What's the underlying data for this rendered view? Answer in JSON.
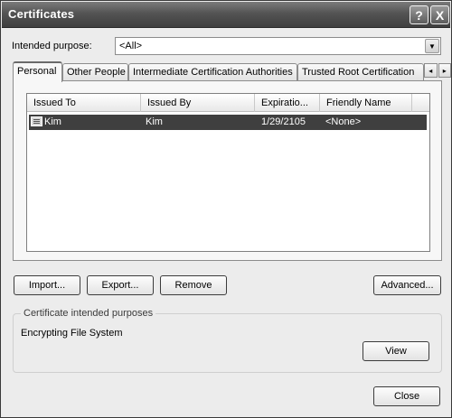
{
  "window": {
    "title": "Certificates",
    "help_glyph": "?",
    "close_glyph": "X"
  },
  "intended_purpose": {
    "label": "Intended purpose:",
    "value": "<All>"
  },
  "tabs": [
    {
      "label": "Personal",
      "active": true
    },
    {
      "label": "Other People",
      "active": false
    },
    {
      "label": "Intermediate Certification Authorities",
      "active": false
    },
    {
      "label": "Trusted Root Certification",
      "active": false
    }
  ],
  "tab_scroll": {
    "left_glyph": "◂",
    "right_glyph": "▸"
  },
  "list": {
    "columns": [
      "Issued To",
      "Issued By",
      "Expiratio...",
      "Friendly Name"
    ],
    "rows": [
      {
        "issued_to": "Kim",
        "issued_by": "Kim",
        "expiration": "1/29/2105",
        "friendly_name": "<None>",
        "selected": true,
        "icon": "certificate-icon"
      }
    ]
  },
  "buttons": {
    "import": "Import...",
    "export": "Export...",
    "remove": "Remove",
    "advanced": "Advanced...",
    "view": "View",
    "close": "Close"
  },
  "purposes_group": {
    "legend": "Certificate intended purposes",
    "text": "Encrypting File System"
  }
}
